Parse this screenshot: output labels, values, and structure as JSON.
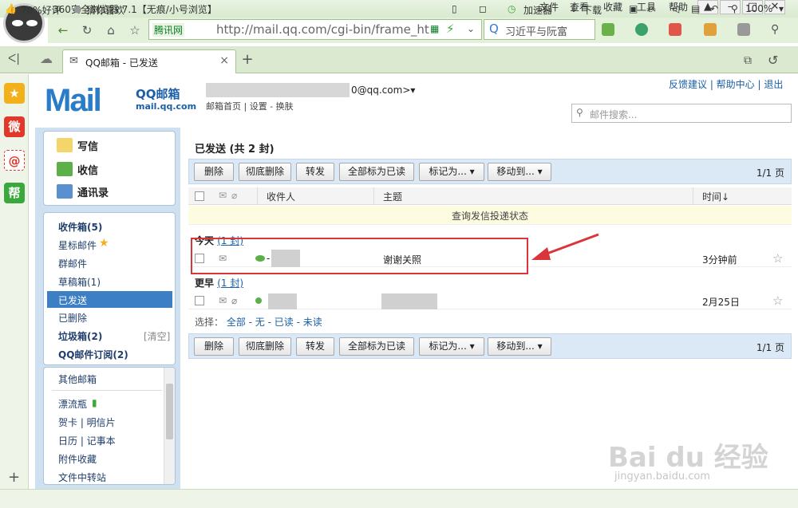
{
  "browser": {
    "title": "360安全浏览器 7.1【无痕/小号浏览】",
    "menu": [
      "文件",
      "查看",
      "收藏",
      "工具",
      "帮助"
    ],
    "url_site": "腾讯网",
    "url": "http://mail.qq.com/cgi-bin/frame_ht",
    "search_text": "习近平与阮富",
    "tab_label": "QQ邮箱 - 已发送",
    "statusbar": {
      "rating": "70%好评",
      "guess": "猜你喜欢",
      "accelerator": "加速器",
      "download": "下载",
      "zoom": "100%"
    }
  },
  "mail": {
    "logo_main": "Mail",
    "brand": "QQ邮箱",
    "domain": "mail.qq.com",
    "account": "0@qq.com>▾",
    "account_links": "邮箱首页 | 设置 - 换肤",
    "top_links": "反馈建议 | 帮助中心 | 退出",
    "search_placeholder": "邮件搜索...",
    "actions": {
      "compose": "写信",
      "inbox": "收信",
      "contacts": "通讯录"
    },
    "folders": {
      "inbox": "收件箱(5)",
      "starred": "星标邮件",
      "group": "群邮件",
      "drafts": "草稿箱(1)",
      "sent": "已发送",
      "deleted": "已删除",
      "spam": "垃圾箱(2)",
      "spam_clear": "[清空]",
      "subscriptions": "QQ邮件订阅(2)",
      "other": "其他邮箱",
      "drift": "漂流瓶",
      "cards": "贺卡 | 明信片",
      "calendar": "日历 | 记事本",
      "attachments": "附件收藏",
      "transfer": "文件中转站"
    },
    "main_title": "已发送 (共 2 封)",
    "toolbar": {
      "delete": "删除",
      "purge": "彻底删除",
      "forward": "转发",
      "mark_all_read": "全部标为已读",
      "mark_as": "标记为... ▾",
      "move_to": "移动到... ▾",
      "pager": "1/1 页"
    },
    "columns": {
      "recipient": "收件人",
      "subject": "主题",
      "time": "时间↓"
    },
    "status_link": "查询发信投递状态",
    "groups": [
      {
        "label": "今天",
        "count": "(1 封)"
      },
      {
        "label": "更早",
        "count": "(1 封)"
      }
    ],
    "rows": [
      {
        "recipient": "-",
        "subject": "谢谢关照",
        "time": "3分钟前"
      },
      {
        "recipient": "",
        "subject": "",
        "time": "2月25日"
      }
    ],
    "select_line": {
      "prefix": "选择：",
      "options": "全部 - 无 - 已读 - 未读"
    }
  },
  "watermark": {
    "logo": "Bai du 经验",
    "url": "jingyan.baidu.com"
  },
  "colors": {
    "accent": "#3d7fc4",
    "highlight_box": "#d9353b",
    "browser_green": "#4a8a2a"
  }
}
